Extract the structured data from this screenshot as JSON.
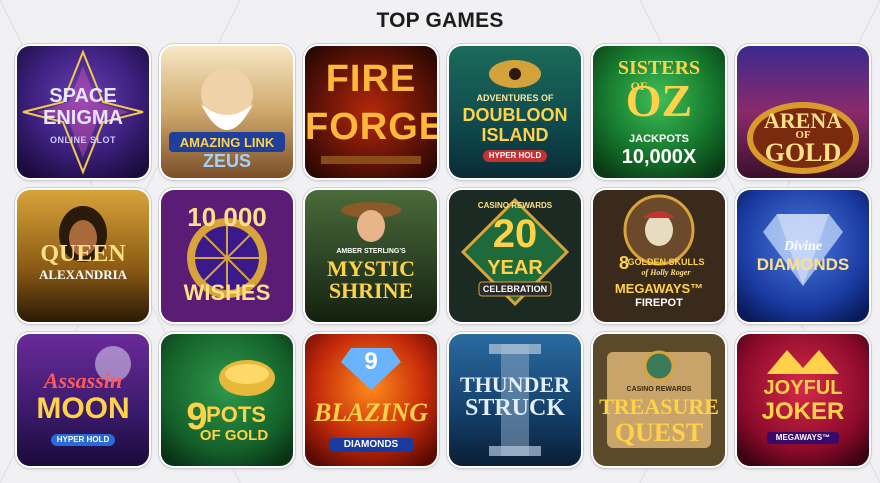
{
  "section": {
    "title": "TOP GAMES"
  },
  "games": [
    {
      "id": "space-enigma",
      "lines": [
        "SPACE",
        "ENIGMA"
      ],
      "sub": "ONLINE SLOT"
    },
    {
      "id": "amazing-link-zeus",
      "lines": [
        "AMAZING LINK",
        "ZEUS"
      ]
    },
    {
      "id": "fire-forge",
      "lines": [
        "FIRE",
        "FORGE"
      ]
    },
    {
      "id": "doubloon-island",
      "lines": [
        "ADVENTURES OF",
        "DOUBLOON",
        "ISLAND"
      ],
      "badge": "HYPER HOLD"
    },
    {
      "id": "sisters-of-oz",
      "lines": [
        "SISTERS",
        "OF",
        "OZ"
      ],
      "sub": "JACKPOTS",
      "big": "10,000X"
    },
    {
      "id": "arena-of-gold",
      "lines": [
        "ARENA",
        "OF",
        "GOLD"
      ]
    },
    {
      "id": "queen-alexandria",
      "lines": [
        "QUEEN",
        "ALEXANDRIA"
      ]
    },
    {
      "id": "10000-wishes",
      "lines": [
        "10 000",
        "WISHES"
      ]
    },
    {
      "id": "mystic-shrine",
      "lines": [
        "AMBER STERLING'S",
        "MYSTIC",
        "SHRINE"
      ]
    },
    {
      "id": "20-year-celebration",
      "lines": [
        "CASINO REWARDS",
        "20",
        "YEAR",
        "CELEBRATION"
      ]
    },
    {
      "id": "8-golden-skulls",
      "lines": [
        "8",
        "GOLDEN SKULLS",
        "of Holly Roger",
        "MEGAWAYS™",
        "FIREPOT"
      ]
    },
    {
      "id": "divine-diamonds",
      "lines": [
        "Divine",
        "DIAMONDS"
      ]
    },
    {
      "id": "assassin-moon",
      "lines": [
        "Assassin",
        "MOON"
      ],
      "badge": "HYPER HOLD"
    },
    {
      "id": "9-pots-of-gold",
      "lines": [
        "9",
        "POTS",
        "OF GOLD"
      ]
    },
    {
      "id": "9-blazing-diamonds",
      "lines": [
        "9",
        "BLAZING",
        "DIAMONDS"
      ]
    },
    {
      "id": "thunderstruck-ii",
      "lines": [
        "THUNDER",
        "STRUCK"
      ]
    },
    {
      "id": "treasure-quest",
      "lines": [
        "CASINO REWARDS",
        "TREASURE",
        "QUEST"
      ]
    },
    {
      "id": "joyful-joker",
      "lines": [
        "JOYFUL",
        "JOKER",
        "MEGAWAYS™"
      ]
    }
  ],
  "colors": {
    "background": "#f1f1f3",
    "title": "#1c1c1c",
    "tile_border": "#ffffff"
  }
}
